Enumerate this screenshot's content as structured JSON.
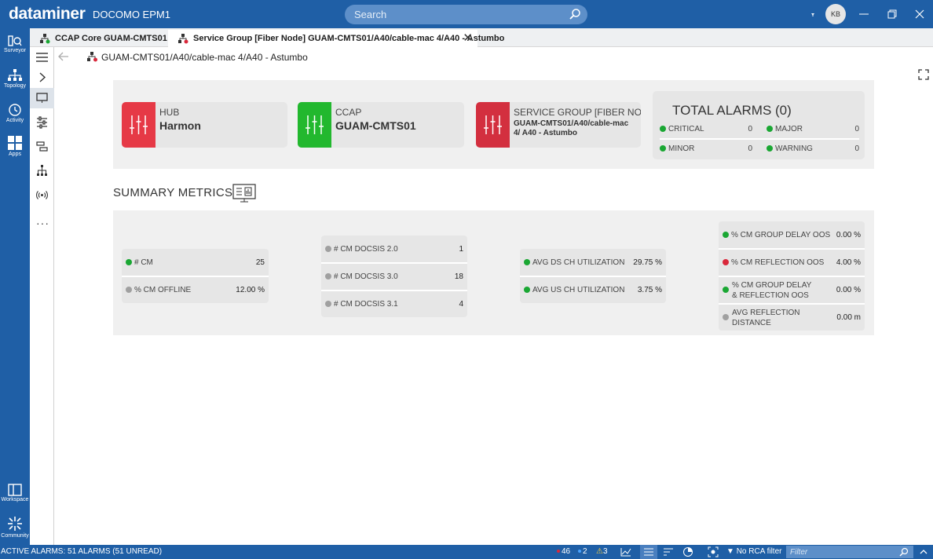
{
  "app": {
    "brand": "dataminer",
    "system_name": "DOCOMO EPM1",
    "user_initials": "KB"
  },
  "search": {
    "placeholder": "Search"
  },
  "left_nav": {
    "surveyor": "Surveyor",
    "topology": "Topology",
    "activity": "Activity",
    "apps": "Apps",
    "workspace": "Workspace",
    "community": "Community"
  },
  "tabs": [
    {
      "label": "CCAP Core GUAM-CMTS01"
    },
    {
      "label": "Service Group [Fiber Node] GUAM-CMTS01/A40/cable-mac 4/A40 - Astumbo"
    }
  ],
  "breadcrumb": "GUAM-CMTS01/A40/cable-mac 4/A40 - Astumbo",
  "entities": [
    {
      "label": "HUB",
      "value": "Harmon",
      "color": "#e63946"
    },
    {
      "label": "CCAP",
      "value": "GUAM-CMTS01",
      "color": "#22b82e"
    },
    {
      "label": "SERVICE GROUP [FIBER NODE]",
      "value": "GUAM-CMTS01/A40/cable-mac 4/ A40 - Astumbo",
      "color": "#d32f3f"
    }
  ],
  "alarms": {
    "title": "TOTAL ALARMS (0)",
    "critical_label": "CRITICAL",
    "critical": "0",
    "major_label": "MAJOR",
    "major": "0",
    "minor_label": "MINOR",
    "minor": "0",
    "warning_label": "WARNING",
    "warning": "0"
  },
  "summary": {
    "title": "SUMMARY METRICS",
    "cm": {
      "label": "# CM",
      "value": "25"
    },
    "cm_offline": {
      "label": "% CM OFFLINE",
      "value": "12.00 %"
    },
    "docsis20": {
      "label": "# CM DOCSIS 2.0",
      "value": "1"
    },
    "docsis30": {
      "label": "# CM DOCSIS 3.0",
      "value": "18"
    },
    "docsis31": {
      "label": "# CM DOCSIS 3.1",
      "value": "4"
    },
    "ds_util": {
      "label": "AVG DS CH UTILIZATION",
      "value": "29.75 %"
    },
    "us_util": {
      "label": "AVG US CH UTILIZATION",
      "value": "3.75 %"
    },
    "group_delay": {
      "label": "% CM GROUP DELAY OOS",
      "value": "0.00 %"
    },
    "reflection": {
      "label": "% CM REFLECTION OOS",
      "value": "4.00 %"
    },
    "group_refl": {
      "label": "% CM GROUP DELAY & REFLECTION OOS",
      "value": "0.00 %"
    },
    "avg_refl": {
      "label": "AVG REFLECTION DISTANCE",
      "value": "0.00 m"
    }
  },
  "footer": {
    "active_alarms": "ACTIVE ALARMS: 51 ALARMS (51 UNREAD)",
    "count_red": "46",
    "count_blue": "2",
    "count_warn": "3",
    "rca": "No RCA filter",
    "filter_placeholder": "Filter"
  }
}
